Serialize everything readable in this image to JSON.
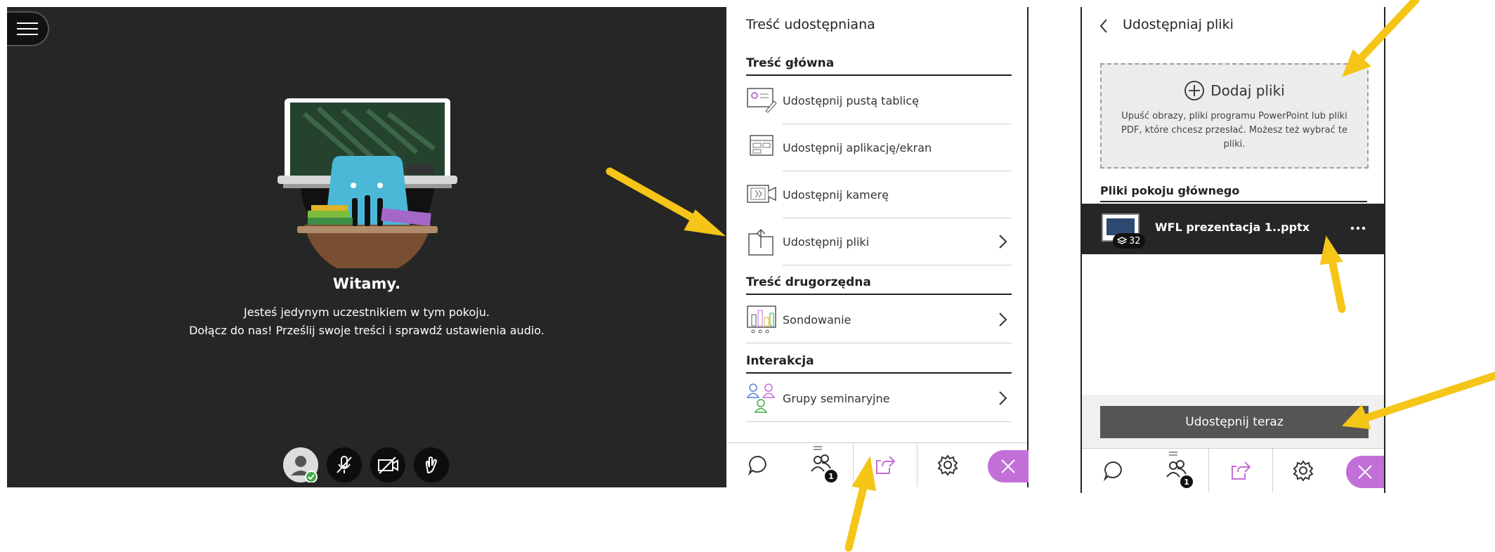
{
  "stage": {
    "welcome_title": "Witamy.",
    "welcome_line1": "Jesteś jedynym uczestnikiem w tym pokoju.",
    "welcome_line2": "Dołącz do nas! Prześlij swoje treści i sprawdź ustawienia audio."
  },
  "share_panel": {
    "title": "Treść udostępniana",
    "primary": {
      "heading": "Treść główna",
      "items": [
        "Udostępnij pustą tablicę",
        "Udostępnij aplikację/ekran",
        "Udostępnij kamerę",
        "Udostępnij pliki"
      ]
    },
    "secondary": {
      "heading": "Treść drugorzędna",
      "items": [
        "Sondowanie"
      ]
    },
    "interaction": {
      "heading": "Interakcja",
      "items": [
        "Grupy seminaryjne"
      ]
    },
    "tabs": {
      "attendees_badge": "1"
    }
  },
  "files_panel": {
    "title": "Udostępniaj pliki",
    "add_label": "Dodaj pliki",
    "drop_text_1": "Upuść obrazy, pliki programu PowerPoint lub pliki",
    "drop_text_2": "PDF, które chcesz przesłać. Możesz też wybrać te",
    "drop_text_3": "pliki.",
    "section_heading": "Pliki pokoju głównego",
    "file_name": "WFL prezentacja 1..pptx",
    "file_slides": "32",
    "share_now": "Udostępnij teraz",
    "tabs": {
      "attendees_badge": "1"
    }
  },
  "colors": {
    "accent_purple": "#c36fd8",
    "arrow_yellow": "#f5c518",
    "stage_bg": "#262626"
  }
}
